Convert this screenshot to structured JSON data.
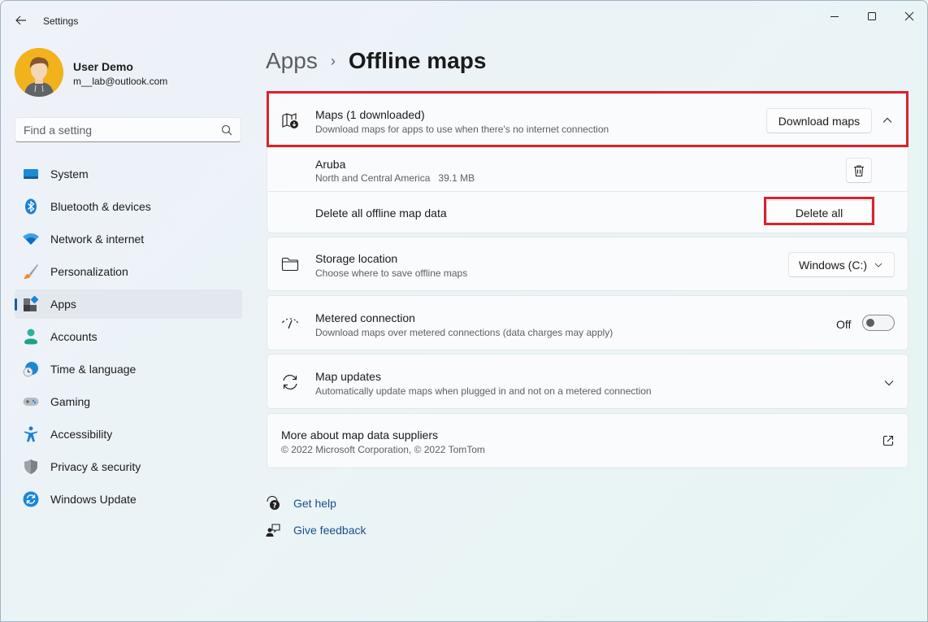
{
  "window": {
    "title": "Settings",
    "controls": {
      "minimize": "minimize-icon",
      "maximize": "maximize-icon",
      "close": "close-icon"
    }
  },
  "profile": {
    "name": "User Demo",
    "email": "m__lab@outlook.com"
  },
  "search": {
    "placeholder": "Find a setting",
    "value": ""
  },
  "sidebar": {
    "items": [
      {
        "label": "System",
        "icon": "system-icon",
        "active": false
      },
      {
        "label": "Bluetooth & devices",
        "icon": "bluetooth-icon",
        "active": false
      },
      {
        "label": "Network & internet",
        "icon": "wifi-icon",
        "active": false
      },
      {
        "label": "Personalization",
        "icon": "brush-icon",
        "active": false
      },
      {
        "label": "Apps",
        "icon": "apps-icon",
        "active": true
      },
      {
        "label": "Accounts",
        "icon": "accounts-icon",
        "active": false
      },
      {
        "label": "Time & language",
        "icon": "time-language-icon",
        "active": false
      },
      {
        "label": "Gaming",
        "icon": "gamepad-icon",
        "active": false
      },
      {
        "label": "Accessibility",
        "icon": "accessibility-icon",
        "active": false
      },
      {
        "label": "Privacy & security",
        "icon": "shield-icon",
        "active": false
      },
      {
        "label": "Windows Update",
        "icon": "windows-update-icon",
        "active": false
      }
    ]
  },
  "breadcrumb": {
    "parent": "Apps",
    "separator": "›",
    "current": "Offline maps"
  },
  "maps_section": {
    "title": "Maps (1 downloaded)",
    "subtitle": "Download maps for apps to use when there's no internet connection",
    "download_button": "Download maps",
    "expanded": true,
    "downloaded_maps": [
      {
        "name": "Aruba",
        "region": "North and Central America",
        "size": "39.1 MB"
      }
    ],
    "delete_all_label": "Delete all offline map data",
    "delete_all_button": "Delete all"
  },
  "storage_location": {
    "title": "Storage location",
    "subtitle": "Choose where to save offline maps",
    "selected": "Windows (C:)"
  },
  "metered_connection": {
    "title": "Metered connection",
    "subtitle": "Download maps over metered connections (data charges may apply)",
    "state_label": "Off",
    "enabled": false
  },
  "map_updates": {
    "title": "Map updates",
    "subtitle": "Automatically update maps when plugged in and not on a metered connection"
  },
  "suppliers": {
    "title": "More about map data suppliers",
    "subtitle": "© 2022 Microsoft Corporation, © 2022 TomTom"
  },
  "footer_links": {
    "help": "Get help",
    "feedback": "Give feedback"
  },
  "colors": {
    "accent": "#0d5fa6",
    "highlight": "#d9232e",
    "link": "#1a4f8a"
  }
}
